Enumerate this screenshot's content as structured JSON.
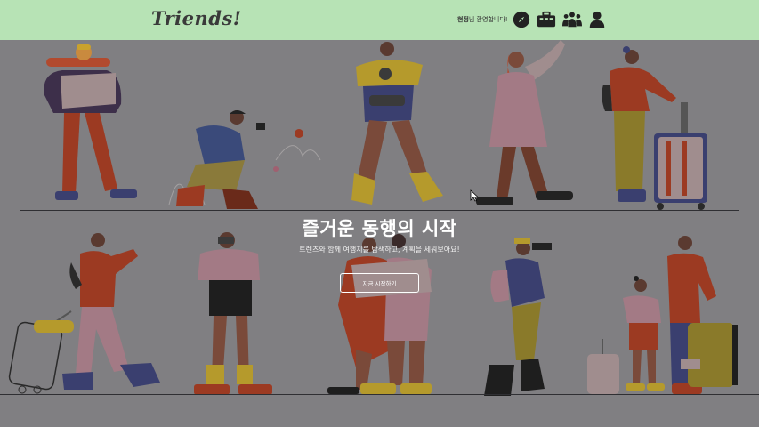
{
  "header": {
    "logo": "Triends!",
    "user_name": "현정",
    "welcome_suffix": "님 환영합니다!",
    "icons": [
      "compass-icon",
      "suitcase-icon",
      "group-icon",
      "user-icon"
    ]
  },
  "hero": {
    "title": "즐거운 동행의 시작",
    "subtitle": "트렌즈와 함께 여행지를 탐색하고, 계획을 세워보아요!",
    "cta_label": "지금 시작하기"
  },
  "colors": {
    "header_bg": "#b7e3b5",
    "hero_overlay": "#807f82",
    "text_white": "#ffffff"
  }
}
